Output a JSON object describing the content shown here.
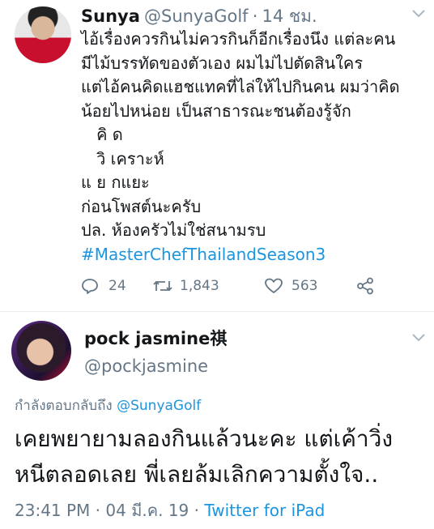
{
  "tweet1": {
    "display_name": "Sunya",
    "handle": "@SunyaGolf",
    "separator": "·",
    "time": "14 ชม.",
    "lines": [
      "ไอ้เรื่องควรกินไม่ควรกินก็อีกเรื่องนึง แต่ละคน",
      "มีไม้บรรทัดของตัวเอง ผมไม่ไปตัดสินใคร",
      "แต่ไอ้คนคิดแฮชแทคที่ไล่ให้ไปกินคน ผมว่าคิด",
      "น้อยไปหน่อย เป็นสาธารณะชนต้องรู้จัก",
      "   คิ ด",
      "   วิ เคราะห์",
      "แ ย กแยะ",
      "ก่อนโพสต์นะครับ",
      "ปล. ห้องครัวไม่ใช่สนามรบ"
    ],
    "hashtag": "#MasterChefThailandSeason3",
    "replies": "24",
    "retweets": "1,843",
    "likes": "563"
  },
  "tweet2": {
    "display_name": "pock jasmine祺",
    "handle": "@pockjasmine",
    "reply_prefix": "กำลังตอบกลับถึง",
    "reply_mention": "@SunyaGolf",
    "lines": [
      "เคยพยายามลองกินแล้วนะคะ แต่เค้าวิ่ง",
      "หนีตลอดเลย พี่เลยล้มเลิกความตั้งใจ.."
    ],
    "timestamp": "23:41 PM · 04 มี.ค. 19 · ",
    "source": "Twitter for iPad"
  },
  "icons": {
    "reply": "reply-icon",
    "retweet": "retweet-icon",
    "like": "heart-icon",
    "share": "share-icon",
    "more": "chevron-down-icon"
  },
  "colors": {
    "link": "#1b95e0",
    "muted": "#657786",
    "text": "#14171a"
  }
}
